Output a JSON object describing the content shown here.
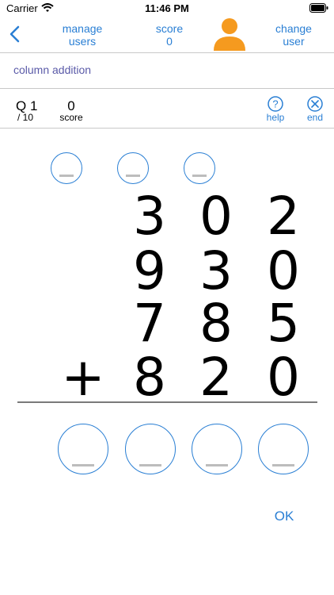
{
  "status_bar": {
    "carrier": "Carrier",
    "time": "11:46 PM"
  },
  "nav": {
    "manage_users": "manage\nusers",
    "score_label": "score",
    "score_value": "0",
    "change_user": "change\nuser"
  },
  "topic": "column addition",
  "question": {
    "label": "Q 1",
    "total": "/ 10",
    "score_value": "0",
    "score_label": "score",
    "help_label": "help",
    "end_label": "end"
  },
  "problem": {
    "operator": "+",
    "rows": [
      [
        "3",
        "0",
        "2"
      ],
      [
        "9",
        "3",
        "0"
      ],
      [
        "7",
        "8",
        "5"
      ],
      [
        "8",
        "2",
        "0"
      ]
    ]
  },
  "actions": {
    "ok_label": "OK"
  },
  "colors": {
    "accent": "#2a7fd4",
    "avatar": "#f59a1f",
    "topic": "#5a5aa8"
  }
}
